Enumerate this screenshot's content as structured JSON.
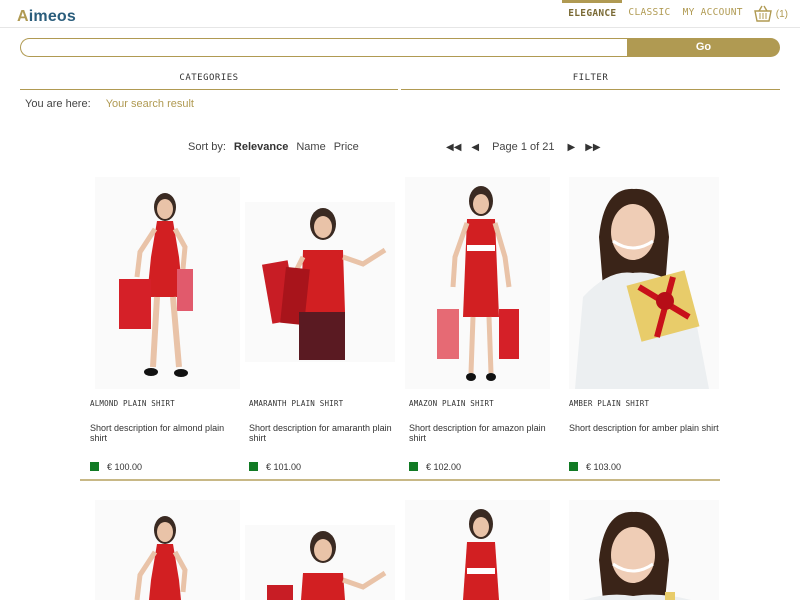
{
  "header": {
    "logo_first": "A",
    "logo_rest": "imeos",
    "nav": [
      "ELEGANCE",
      "CLASSIC",
      "MY ACCOUNT"
    ],
    "active_nav": "ELEGANCE",
    "basket_count": "(1)"
  },
  "search": {
    "value": "",
    "placeholder": "",
    "button_label": "Go"
  },
  "tabs": {
    "categories": "CATEGORIES",
    "filter": "FILTER"
  },
  "breadcrumb": {
    "label": "You are here:",
    "current": "Your search result"
  },
  "sort": {
    "label": "Sort by:",
    "options": [
      "Relevance",
      "Name",
      "Price"
    ],
    "active": "Relevance"
  },
  "pagination": {
    "first": "◀◀",
    "prev": "◀",
    "text": "Page 1 of 21",
    "next": "▶",
    "last": "▶▶"
  },
  "products": [
    {
      "name": "ALMOND PLAIN SHIRT",
      "desc": "Short description for almond plain shirt",
      "price": "€ 100.00"
    },
    {
      "name": "AMARANTH PLAIN SHIRT",
      "desc": "Short description for amaranth plain shirt",
      "price": "€ 101.00"
    },
    {
      "name": "AMAZON PLAIN SHIRT",
      "desc": "Short description for amazon plain shirt",
      "price": "€ 102.00"
    },
    {
      "name": "AMBER PLAIN SHIRT",
      "desc": "Short description for amber plain shirt",
      "price": "€ 103.00"
    }
  ],
  "colors": {
    "accent": "#b09a52",
    "logo_blue": "#2a5d7c",
    "stock_green": "#117a24",
    "dress_red": "#d21f22"
  }
}
